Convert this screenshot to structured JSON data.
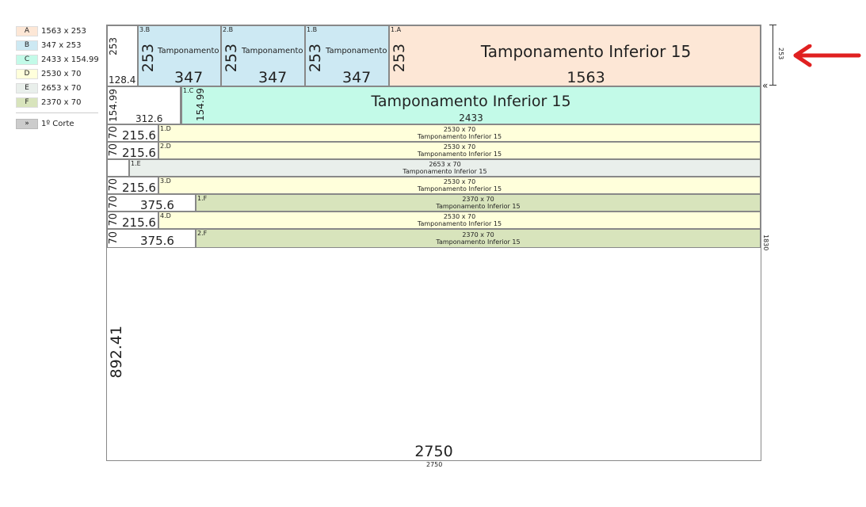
{
  "legend": {
    "items": [
      {
        "key": "A",
        "label": "1563 x 253",
        "color": "#fde7d6"
      },
      {
        "key": "B",
        "label": "347 x 253",
        "color": "#cde9f3"
      },
      {
        "key": "C",
        "label": "2433 x 154.99",
        "color": "#c3fae8"
      },
      {
        "key": "D",
        "label": "2530 x 70",
        "color": "#ffffdb"
      },
      {
        "key": "E",
        "label": "2653 x 70",
        "color": "#e9efeb"
      },
      {
        "key": "F",
        "label": "2370 x 70",
        "color": "#d8e4bc"
      }
    ],
    "cut_button": {
      "icon": "»",
      "label": "1º Corte"
    }
  },
  "board": {
    "width_label": "2750",
    "width_dim": "2750",
    "height_dim": "1830",
    "row_dim": "253",
    "bottom_waste_height": "892.41"
  },
  "row1": {
    "waste": {
      "h": "253",
      "w": "128.4"
    },
    "b_pieces": [
      {
        "id": "3.B",
        "h": "253",
        "name": "Tamponamento",
        "w": "347"
      },
      {
        "id": "2.B",
        "h": "253",
        "name": "Tamponamento",
        "w": "347"
      },
      {
        "id": "1.B",
        "h": "253",
        "name": "Tamponamento",
        "w": "347"
      }
    ],
    "a_piece": {
      "id": "1.A",
      "h": "253",
      "name": "Tamponamento Inferior 15",
      "w": "1563"
    }
  },
  "row2": {
    "waste": {
      "h": "154.99",
      "w": "312.6"
    },
    "c_piece": {
      "id": "1.C",
      "h": "154.99",
      "name": "Tamponamento Inferior 15",
      "w": "2433"
    }
  },
  "strips": [
    {
      "h": "70",
      "waste": "215.6",
      "id": "1.D",
      "size": "2530 x 70",
      "name": "Tamponamento Inferior 15"
    },
    {
      "h": "70",
      "waste": "215.6",
      "id": "2.D",
      "size": "2530 x 70",
      "name": "Tamponamento Inferior 15"
    },
    {
      "h": "",
      "waste": "",
      "id": "1.E",
      "size": "2653 x 70",
      "name": "Tamponamento Inferior 15"
    },
    {
      "h": "70",
      "waste": "215.6",
      "id": "3.D",
      "size": "2530 x 70",
      "name": "Tamponamento Inferior 15"
    },
    {
      "h": "70",
      "waste": "375.6",
      "id": "1.F",
      "size": "2370 x 70",
      "name": "Tamponamento Inferior 15"
    },
    {
      "h": "70",
      "waste": "215.6",
      "id": "4.D",
      "size": "2530 x 70",
      "name": "Tamponamento Inferior 15"
    },
    {
      "h": "70",
      "waste": "375.6",
      "id": "2.F",
      "size": "2370 x 70",
      "name": "Tamponamento Inferior 15"
    }
  ],
  "colors": {
    "annotation_arrow": "#e02020"
  }
}
